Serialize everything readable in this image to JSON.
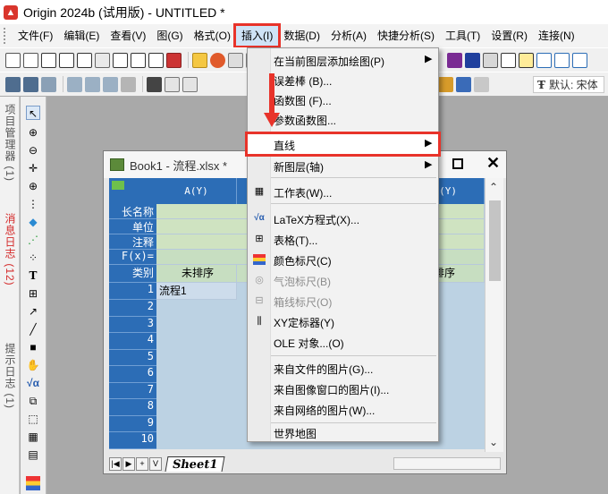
{
  "window": {
    "title": "Origin 2024b (试用版) - UNTITLED *",
    "app_icon": "origin-app-icon",
    "brand_color": "#d9352c"
  },
  "menubar": {
    "items": [
      {
        "label": "文件(F)"
      },
      {
        "label": "编辑(E)"
      },
      {
        "label": "查看(V)"
      },
      {
        "label": "图(G)"
      },
      {
        "label": "格式(O)"
      },
      {
        "label": "插入(I)"
      },
      {
        "label": "数据(D)"
      },
      {
        "label": "分析(A)"
      },
      {
        "label": "快捷分析(S)"
      },
      {
        "label": "工具(T)"
      },
      {
        "label": "设置(R)"
      },
      {
        "label": "连接(N)"
      }
    ],
    "active_index": 5
  },
  "toolbar": {
    "font_box_label": "默认: 宋体"
  },
  "left_tabs": {
    "project_manager": "项目管理器 (1)",
    "messages_log": "消息日志 (12)",
    "hint_log": "提示日志 (1)"
  },
  "book": {
    "title": "Book1 - 流程.xlsx *",
    "col_a_header": "A(Y)",
    "col_c_header": "(Y)",
    "row_labels": [
      "长名称",
      "单位",
      "注释",
      "F(x)=",
      "类别"
    ],
    "category_a": "未排序",
    "category_c": "排序",
    "row_numbers": [
      "1",
      "2",
      "3",
      "4",
      "5",
      "6",
      "7",
      "8",
      "9",
      "10"
    ],
    "cell_a1": "流程1",
    "cell_b2": "流",
    "sheet_tab": "Sheet1"
  },
  "insert_menu": {
    "items": [
      {
        "label": "在当前图层添加绘图(P)",
        "submenu": true
      },
      {
        "label": "误差棒 (B)..."
      },
      {
        "label": "函数图 (F)..."
      },
      {
        "label": "参数函数图..."
      },
      {
        "label": "直线",
        "submenu": true,
        "highlighted": true
      },
      {
        "label": "新图层(轴)",
        "submenu": true
      },
      {
        "label": "工作表(W)..."
      },
      {
        "label": "LaTeX方程式(X)..."
      },
      {
        "label": "表格(T)..."
      },
      {
        "label": "颜色标尺(C)"
      },
      {
        "label": "气泡标尺(B)",
        "disabled": true
      },
      {
        "label": "箱线标尺(O)",
        "disabled": true
      },
      {
        "label": "XY定标器(Y)"
      },
      {
        "label": "OLE 对象...(O)"
      },
      {
        "label": "来自文件的图片(G)..."
      },
      {
        "label": "来自图像窗口的图片(I)..."
      },
      {
        "label": "来自网络的图片(W)..."
      },
      {
        "label": "世界地图"
      }
    ]
  },
  "colors": {
    "highlight_border": "#e8332a",
    "grid_header": "#2c6db6",
    "meta_row": "#cfe3c1",
    "data_cell": "#bcd2e3"
  }
}
